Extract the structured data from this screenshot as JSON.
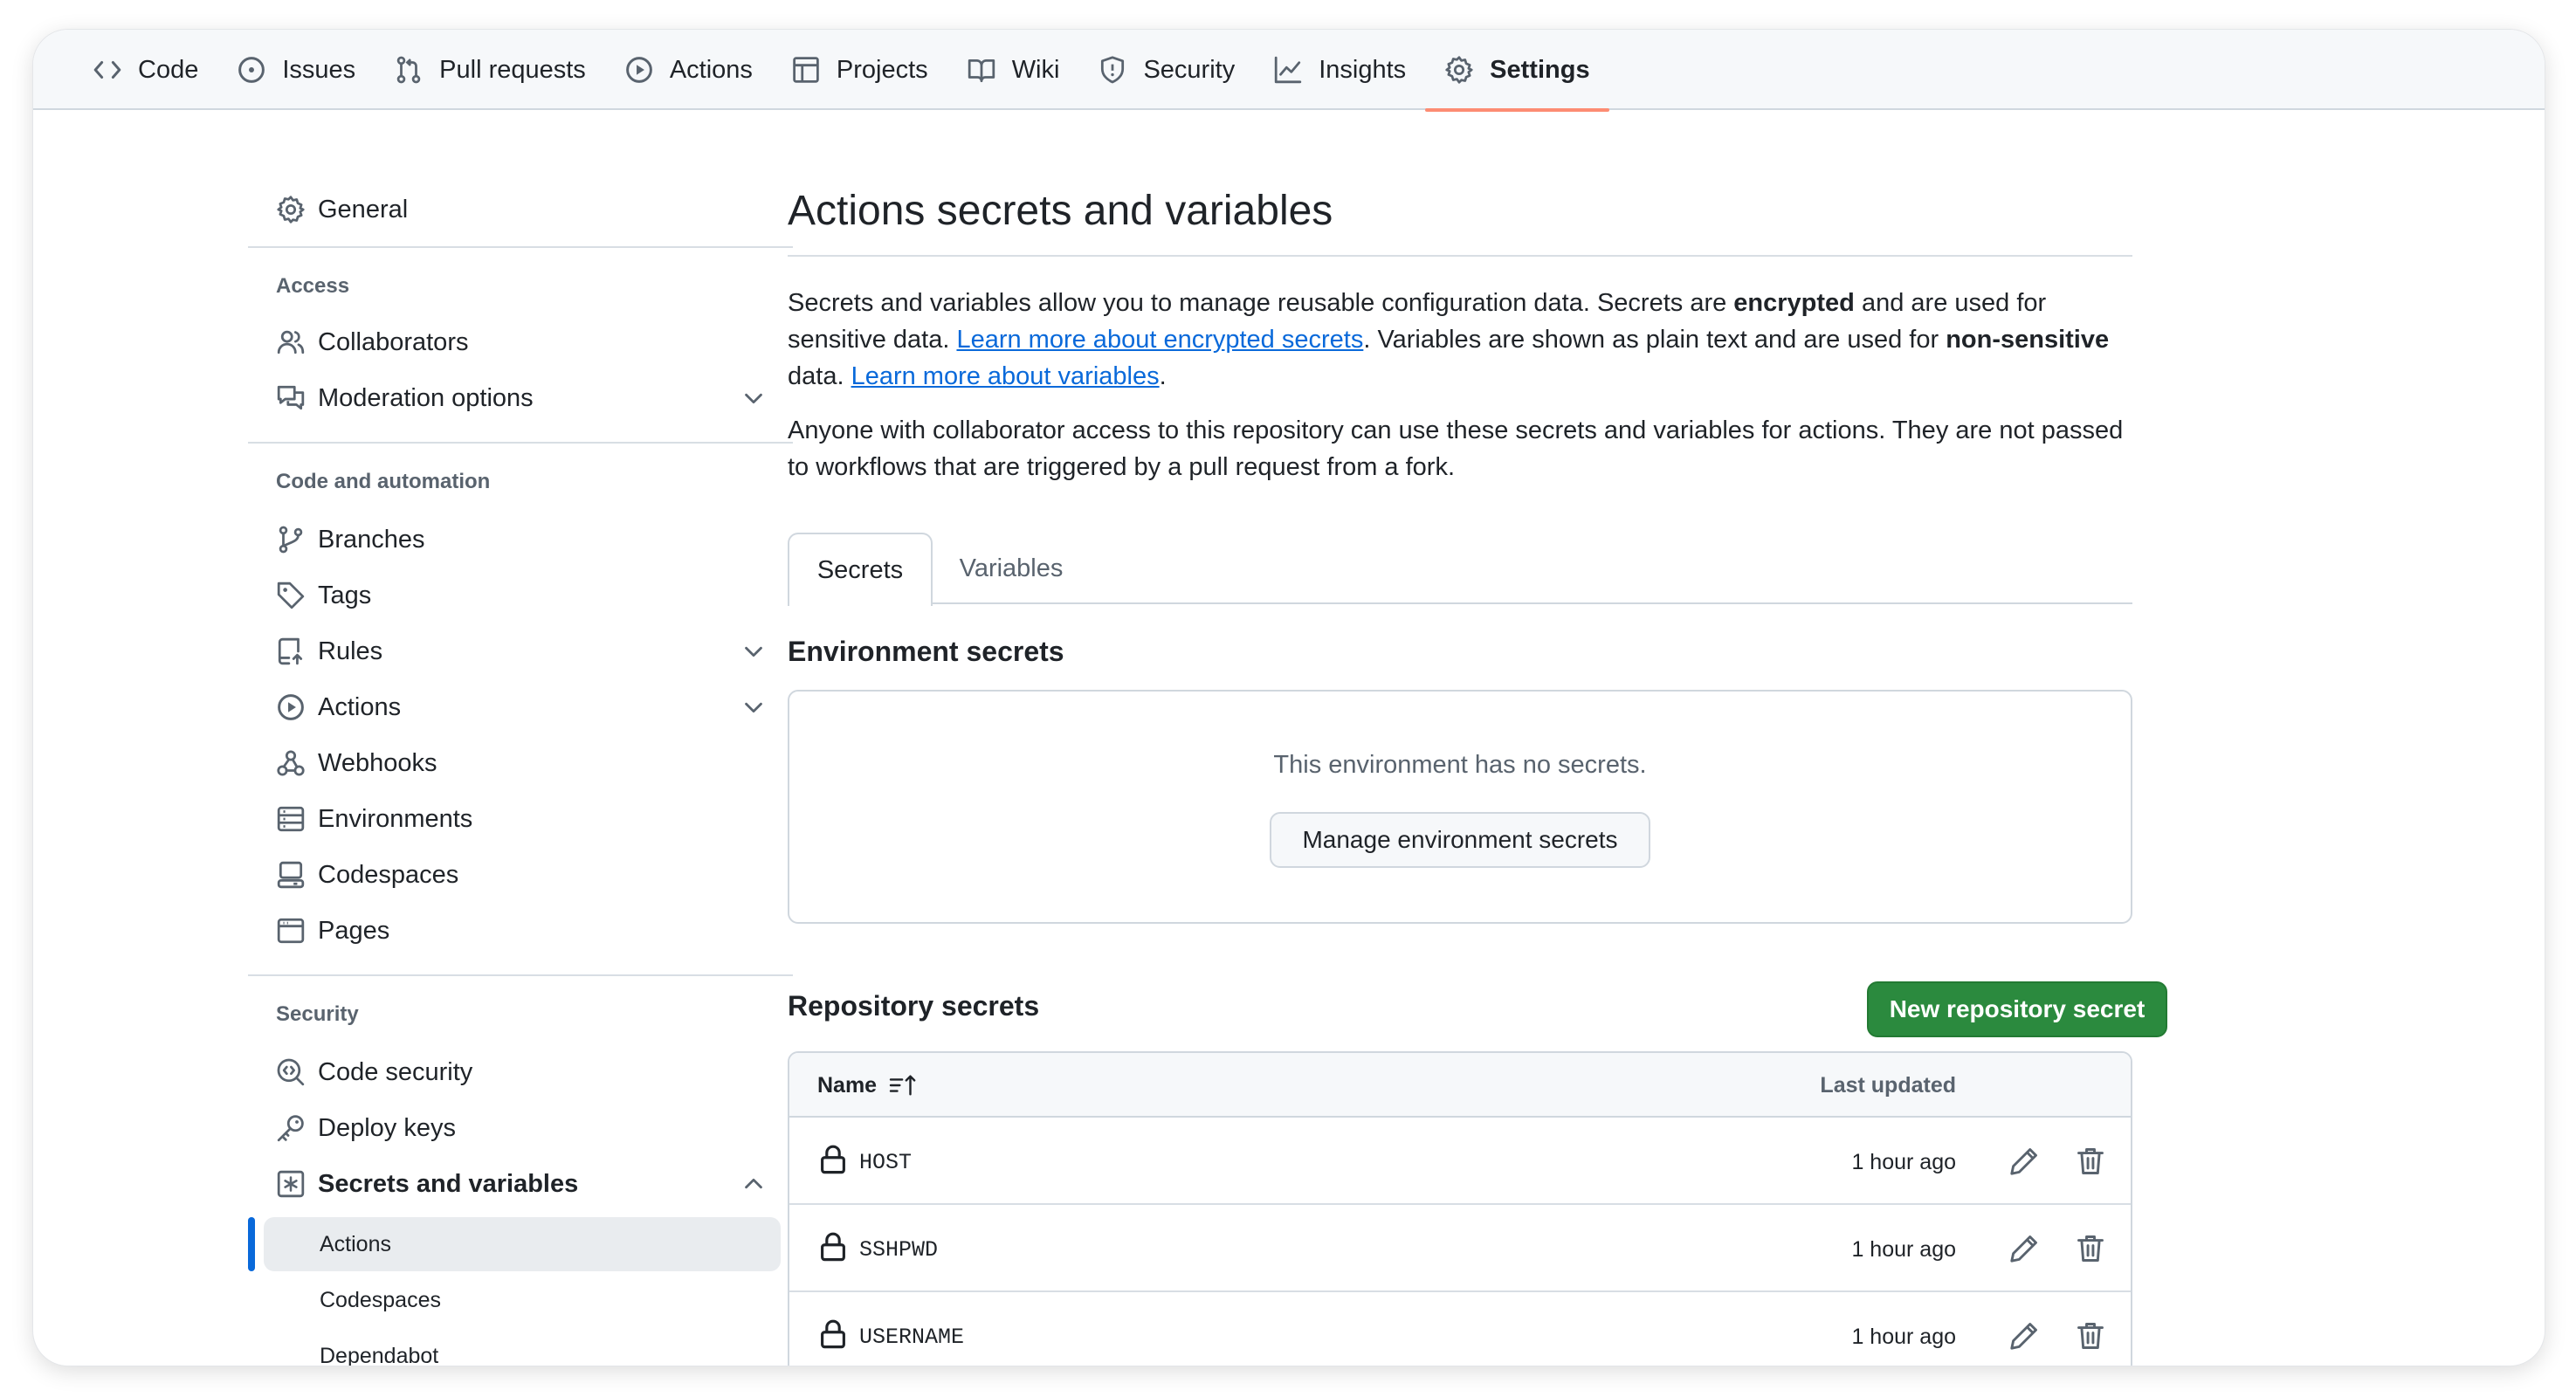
{
  "nav": {
    "tabs": [
      {
        "label": "Code",
        "icon": "code-icon"
      },
      {
        "label": "Issues",
        "icon": "issue-icon"
      },
      {
        "label": "Pull requests",
        "icon": "pull-request-icon"
      },
      {
        "label": "Actions",
        "icon": "play-icon"
      },
      {
        "label": "Projects",
        "icon": "table-icon"
      },
      {
        "label": "Wiki",
        "icon": "book-icon"
      },
      {
        "label": "Security",
        "icon": "shield-icon"
      },
      {
        "label": "Insights",
        "icon": "graph-icon"
      },
      {
        "label": "Settings",
        "icon": "gear-icon",
        "active": true
      }
    ],
    "active_underline_color": "#fd8c73"
  },
  "sidebar": {
    "general": "General",
    "access_heading": "Access",
    "collaborators": "Collaborators",
    "moderation": "Moderation options",
    "code_heading": "Code and automation",
    "branches": "Branches",
    "tags": "Tags",
    "rules": "Rules",
    "actions": "Actions",
    "webhooks": "Webhooks",
    "environments": "Environments",
    "codespaces": "Codespaces",
    "pages": "Pages",
    "security_heading": "Security",
    "code_security": "Code security",
    "deploy_keys": "Deploy keys",
    "secrets_variables": "Secrets and variables",
    "sub_actions": "Actions",
    "sub_codespaces": "Codespaces",
    "sub_dependabot": "Dependabot",
    "selected_color": "#0969da"
  },
  "main": {
    "title": "Actions secrets and variables",
    "intro_1": "Secrets and variables allow you to manage reusable configuration data. Secrets are ",
    "intro_encrypted": "encrypted",
    "intro_2": " and are used for sensitive data. ",
    "link_secrets": "Learn more about encrypted secrets",
    "intro_3": ". Variables are shown as plain text and are used for ",
    "intro_nonsensitive": "non-sensitive",
    "intro_4": " data. ",
    "link_variables": "Learn more about variables",
    "intro_5": ".",
    "access_note": "Anyone with collaborator access to this repository can use these secrets and variables for actions. They are not passed to workflows that are triggered by a pull request from a fork.",
    "tab_secrets": "Secrets",
    "tab_variables": "Variables",
    "env_heading": "Environment secrets",
    "env_empty": "This environment has no secrets.",
    "env_button": "Manage environment secrets",
    "repo_heading": "Repository secrets",
    "new_secret_button": "New repository secret",
    "primary_color": "#2b8a3e",
    "table": {
      "col_name": "Name",
      "col_updated": "Last updated",
      "rows": [
        {
          "name": "HOST",
          "updated": "1 hour ago"
        },
        {
          "name": "SSHPWD",
          "updated": "1 hour ago"
        },
        {
          "name": "USERNAME",
          "updated": "1 hour ago"
        }
      ]
    }
  }
}
